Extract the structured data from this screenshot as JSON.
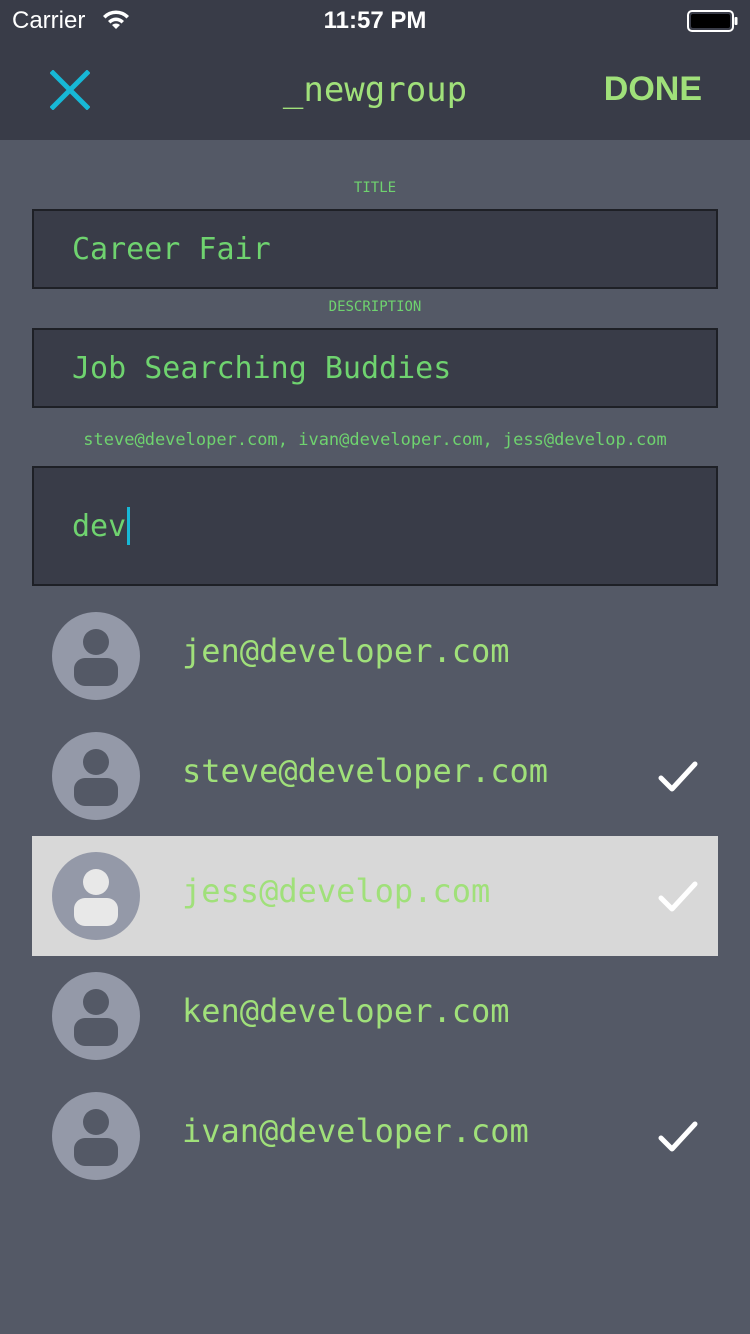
{
  "status_bar": {
    "carrier": "Carrier",
    "time": "11:57 PM",
    "wifi_icon": "wifi-icon",
    "battery_icon": "battery-icon"
  },
  "nav": {
    "close_icon": "close-icon",
    "title": "_newgroup",
    "done_label": "DONE"
  },
  "form": {
    "title_label": "TITLE",
    "title_value": "Career Fair",
    "description_label": "DESCRIPTION",
    "description_value": "Job Searching Buddies",
    "recipients": "steve@developer.com, ivan@developer.com, jess@develop.com",
    "search_value": "dev"
  },
  "contacts": [
    {
      "email": "jen@developer.com",
      "selected": false,
      "highlighted": false
    },
    {
      "email": "steve@developer.com",
      "selected": true,
      "highlighted": false
    },
    {
      "email": "jess@develop.com",
      "selected": true,
      "highlighted": true
    },
    {
      "email": "ken@developer.com",
      "selected": false,
      "highlighted": false
    },
    {
      "email": "ivan@developer.com",
      "selected": true,
      "highlighted": false
    }
  ],
  "colors": {
    "background": "#545966",
    "bar": "#393c48",
    "accent_green": "#a0e07a",
    "label_green": "#6fd36f",
    "close_cyan": "#17b8d6",
    "highlight_row": "#d8d8d8"
  }
}
